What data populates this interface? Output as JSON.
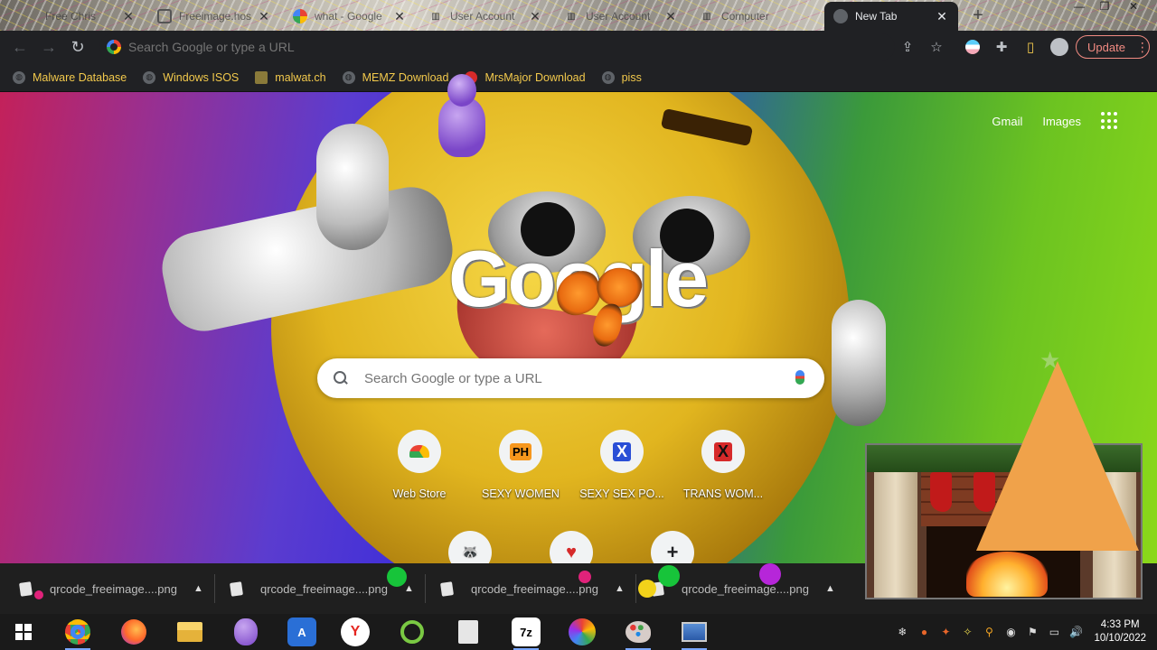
{
  "browser": {
    "tabs": [
      {
        "title": "Free Chris",
        "active": false
      },
      {
        "title": "Freeimage.hos",
        "active": false
      },
      {
        "title": "what - Google",
        "active": false
      },
      {
        "title": "User Account",
        "active": false
      },
      {
        "title": "User Account",
        "active": false
      },
      {
        "title": "Computer",
        "active": false
      },
      {
        "title": "New Tab",
        "active": true
      }
    ],
    "address_placeholder": "Search Google or type a URL",
    "update_label": "Update"
  },
  "bookmarks": [
    {
      "label": "Malware Database"
    },
    {
      "label": "Windows ISOS"
    },
    {
      "label": "malwat.ch"
    },
    {
      "label": "MEMZ Download"
    },
    {
      "label": "MrsMajor Download"
    },
    {
      "label": "piss"
    }
  ],
  "newtab": {
    "top_links": [
      "Gmail",
      "Images"
    ],
    "logo": "Google",
    "search_placeholder": "Search Google or type a URL",
    "shortcuts": [
      {
        "label": "Web Store",
        "glyph": "",
        "color": "#4285f4"
      },
      {
        "label": "SEXY WOMEN",
        "glyph": "PH",
        "color": "#f7971d"
      },
      {
        "label": "SEXY SEX PO...",
        "glyph": "X",
        "color": "#2a4fd6"
      },
      {
        "label": "TRANS WOM...",
        "glyph": "X",
        "color": "#d62a2a"
      }
    ],
    "shortcuts_row2": [
      {
        "glyph": "🦝"
      },
      {
        "glyph": "♥"
      },
      {
        "glyph": "+"
      }
    ]
  },
  "downloads": [
    {
      "filename": "qrcode_freeimage....png"
    },
    {
      "filename": "qrcode_freeimage....png"
    },
    {
      "filename": "qrcode_freeimage....png"
    },
    {
      "filename": "qrcode_freeimage....png"
    }
  ],
  "taskbar": {
    "apps": [
      {
        "name": "chrome",
        "glyph": "",
        "bg": "#1a1a1a"
      },
      {
        "name": "firefox",
        "glyph": "",
        "bg": "#1a1a1a"
      },
      {
        "name": "file-explorer",
        "glyph": "",
        "bg": "#1a1a1a"
      },
      {
        "name": "bonzi",
        "glyph": "",
        "bg": "#1a1a1a"
      },
      {
        "name": "app-store",
        "glyph": "A",
        "bg": "#2a6fd6"
      },
      {
        "name": "yandex",
        "glyph": "Y",
        "bg": "#ffffff"
      },
      {
        "name": "green-app",
        "glyph": "",
        "bg": "#1a1a1a"
      },
      {
        "name": "files",
        "glyph": "",
        "bg": "#1a1a1a"
      },
      {
        "name": "7zip",
        "glyph": "7z",
        "bg": "#ffffff"
      },
      {
        "name": "colorful-app",
        "glyph": "",
        "bg": "#1a1a1a"
      },
      {
        "name": "paint",
        "glyph": "",
        "bg": "#1a1a1a"
      },
      {
        "name": "computer",
        "glyph": "",
        "bg": "#1a1a1a"
      }
    ],
    "time": "4:33 PM",
    "date": "10/10/2022"
  },
  "colors": {
    "accent_update": "#f28b82",
    "bookmark_text": "#f2c94c",
    "toolbar_bg": "#202124"
  }
}
